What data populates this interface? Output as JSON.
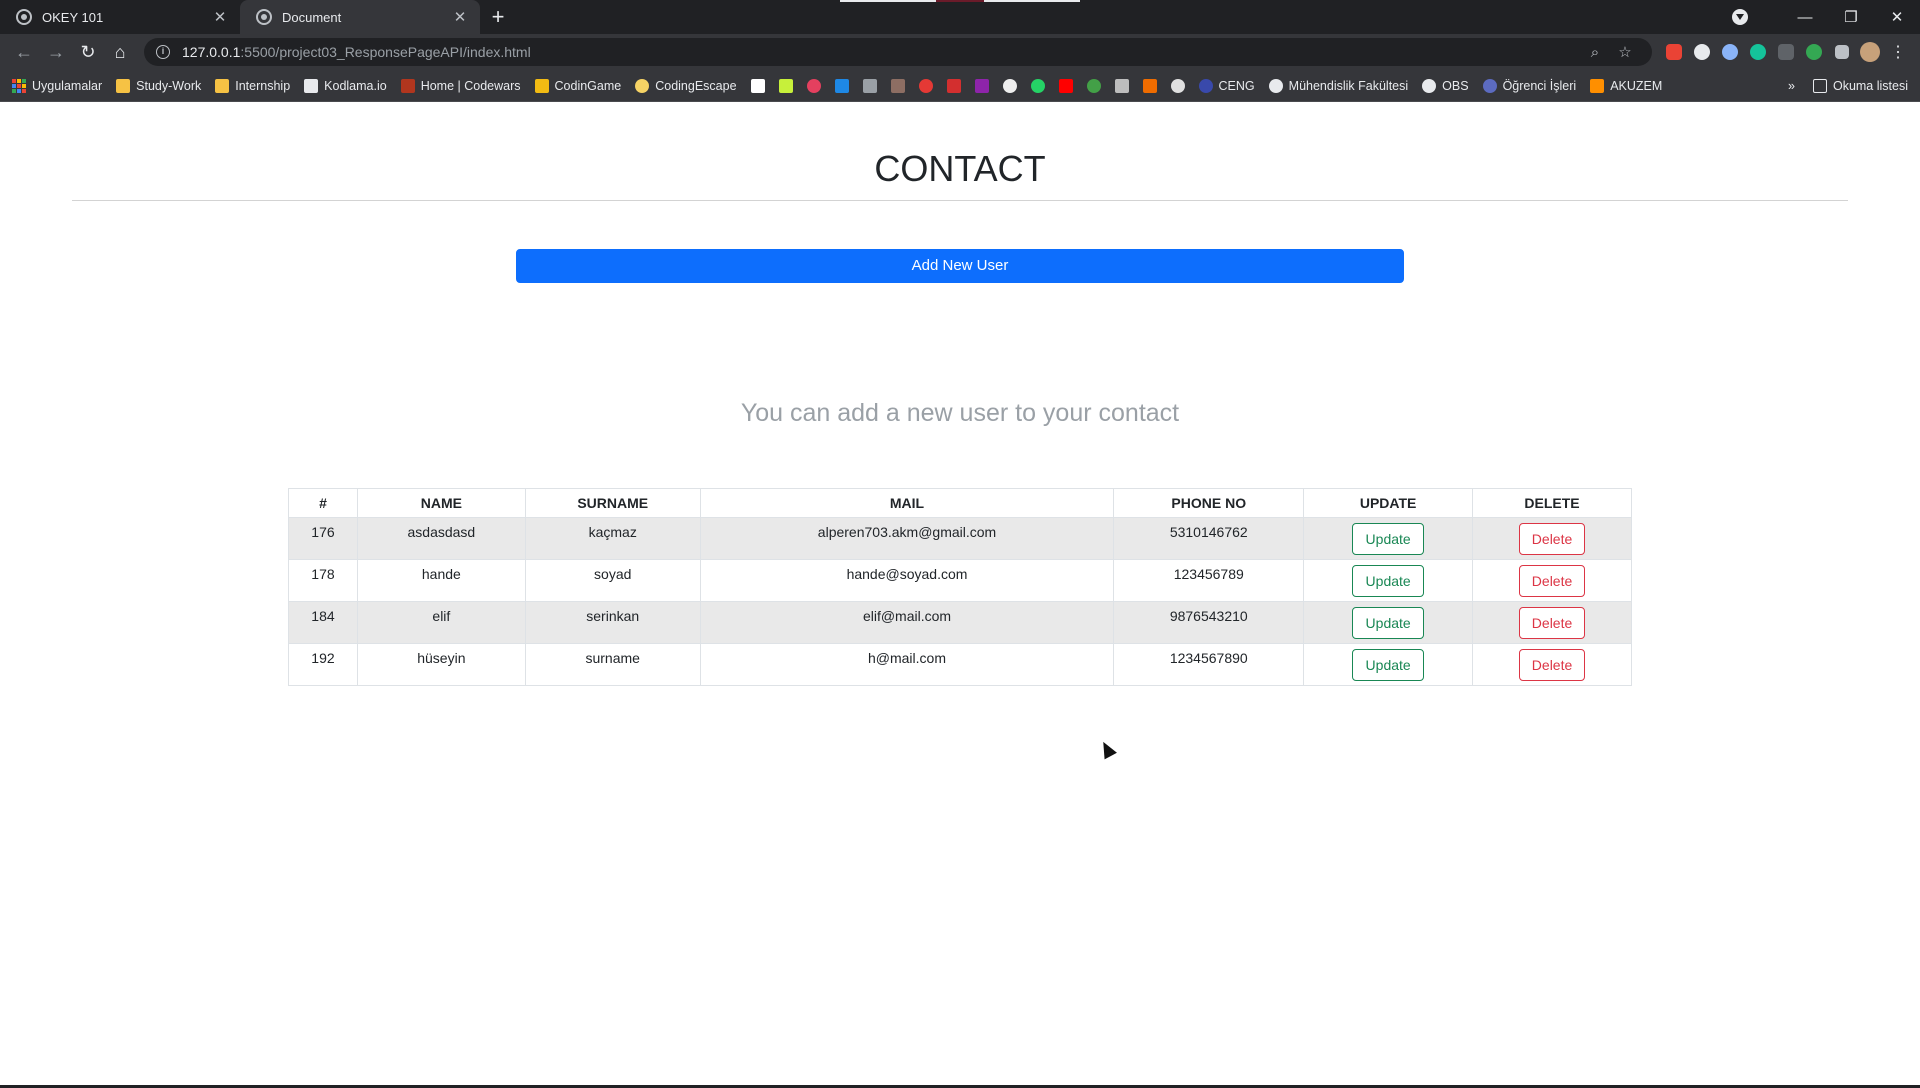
{
  "browser": {
    "tabs": [
      {
        "title": "OKEY 101",
        "active": false
      },
      {
        "title": "Document",
        "active": true
      }
    ],
    "url_host": "127.0.0.1",
    "url_path": ":5500/project03_ResponsePageAPI/index.html",
    "bookmarks": [
      {
        "label": "Uygulamalar",
        "icon": "apps-grid-icon"
      },
      {
        "label": "Study-Work",
        "icon": "folder-icon",
        "color": "#f6c244"
      },
      {
        "label": "Internship",
        "icon": "folder-icon",
        "color": "#f6c244"
      },
      {
        "label": "Kodlama.io",
        "icon": "kodlama-icon",
        "color": "#e8eaed"
      },
      {
        "label": "Home | Codewars",
        "icon": "codewars-icon",
        "color": "#b1361e"
      },
      {
        "label": "CodinGame",
        "icon": "codingame-icon",
        "color": "#f2bb13"
      },
      {
        "label": "CodingEscape",
        "icon": "codingescape-icon",
        "color": "#f6d365"
      }
    ],
    "bookmark_icons": [
      {
        "icon": "wikipedia-icon",
        "color": "#ffffff"
      },
      {
        "icon": "s-icon",
        "color": "#c7f03a"
      },
      {
        "icon": "tiktok-icon",
        "color": "#e4405f"
      },
      {
        "icon": "shield-icon",
        "color": "#1e88e5"
      },
      {
        "icon": "pen-icon",
        "color": "#9aa0a6"
      },
      {
        "icon": "image-icon",
        "color": "#8d6e63"
      },
      {
        "icon": "d-icon",
        "color": "#e53935"
      },
      {
        "icon": "red-icon",
        "color": "#d32f2f"
      },
      {
        "icon": "purple-icon",
        "color": "#8e24aa"
      },
      {
        "icon": "mask-icon",
        "color": "#eeeeee"
      },
      {
        "icon": "whatsapp-icon",
        "color": "#25d366"
      },
      {
        "icon": "youtube-icon",
        "color": "#ff0000"
      },
      {
        "icon": "leaf-icon",
        "color": "#43a047"
      },
      {
        "icon": "slash-icon",
        "color": "#bdbdbd"
      },
      {
        "icon": "jt-icon",
        "color": "#ef6c00"
      },
      {
        "icon": "circle-icon",
        "color": "#e0e0e0"
      }
    ],
    "bookmarks_right": [
      {
        "label": "CENG",
        "icon": "ceng-icon",
        "color": "#3949ab"
      },
      {
        "label": "Mühendislik Fakültesi",
        "icon": "wordpress-icon",
        "color": "#e8eaed"
      },
      {
        "label": "OBS",
        "icon": "globe-icon",
        "color": "#e8eaed"
      },
      {
        "label": "Öğrenci İşleri",
        "icon": "university-icon",
        "color": "#5c6bc0"
      },
      {
        "label": "AKUZEM",
        "icon": "akuzem-icon",
        "color": "#ff8f00"
      }
    ],
    "more_label": "»",
    "reading_list": "Okuma listesi"
  },
  "page": {
    "heading": "CONTACT",
    "add_button": "Add New User",
    "subtitle": "You can add a new user to your contact"
  },
  "table": {
    "headers": [
      "#",
      "NAME",
      "SURNAME",
      "MAIL",
      "PHONE NO",
      "UPDATE",
      "DELETE"
    ],
    "rows": [
      {
        "id": "176",
        "name": "asdasdasd",
        "surname": "kaçmaz",
        "mail": "alperen703.akm@gmail.com",
        "phone": "5310146762",
        "update": "Update",
        "delete": "Delete"
      },
      {
        "id": "178",
        "name": "hande",
        "surname": "soyad",
        "mail": "hande@soyad.com",
        "phone": "123456789",
        "update": "Update",
        "delete": "Delete"
      },
      {
        "id": "184",
        "name": "elif",
        "surname": "serinkan",
        "mail": "elif@mail.com",
        "phone": "9876543210",
        "update": "Update",
        "delete": "Delete"
      },
      {
        "id": "192",
        "name": "hüseyin",
        "surname": "surname",
        "mail": "h@mail.com",
        "phone": "1234567890",
        "update": "Update",
        "delete": "Delete"
      }
    ]
  },
  "colors": {
    "primary": "#0d6efd",
    "update": "#198754",
    "delete": "#dc3545"
  }
}
